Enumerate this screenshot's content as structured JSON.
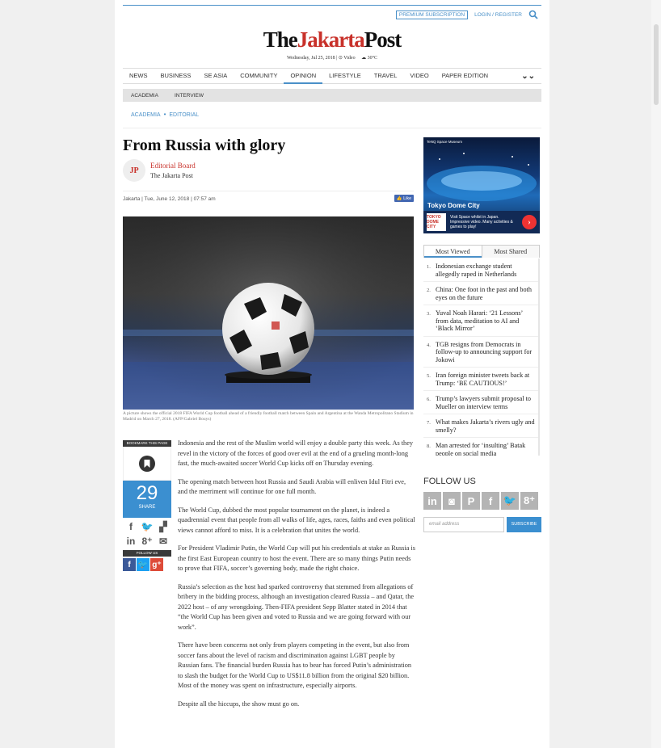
{
  "header": {
    "premium": "PREMIUM SUBSCRIPTION",
    "login": "LOGIN / REGISTER",
    "logo_the": "The",
    "logo_jakarta": "Jakarta",
    "logo_post": "Post",
    "date": "Wednesday, Jul 25, 2018",
    "video": "Video",
    "weather": "30°C"
  },
  "nav": [
    "NEWS",
    "BUSINESS",
    "SE ASIA",
    "COMMUNITY",
    "OPINION",
    "LIFESTYLE",
    "TRAVEL",
    "VIDEO",
    "PAPER EDITION"
  ],
  "subnav": [
    "ACADEMIA",
    "INTERVIEW"
  ],
  "breadcrumb": [
    "ACADEMIA",
    "EDITORIAL"
  ],
  "article": {
    "title": "From Russia with glory",
    "avatar": "JP",
    "author": "Editorial Board",
    "publication": "The Jakarta Post",
    "dateinfo": "Jakarta | Tue, June 12, 2018 | 07:57 am",
    "like": "Like",
    "caption": "A picture shows the official 2018 FIFA World Cup football ahead of a friendly football match between Spain and Argentina at the Wanda Metropolitano Stadium in Madrid on March 27, 2018. (AFP/Gabriel Bouys)",
    "paragraphs": [
      "Indonesia and the rest of the Muslim world will enjoy a double party this week. As they revel in the victory of the forces of good over evil at the end of a grueling month-long fast, the much-awaited soccer World Cup kicks off on Thursday evening.",
      "The opening match between host Russia and Saudi Arabia will enliven Idul Fitri eve, and the merriment will continue for one full month.",
      "The World Cup, dubbed the most popular tournament on the planet, is indeed a quadrennial event that people from all walks of life, ages, races, faiths and even political views cannot afford to miss. It is a celebration that unites the world.",
      "For President Vladimir Putin, the World Cup will put his credentials at stake as Russia is the first East European country to host the event. There are so many things Putin needs to prove that FIFA, soccer’s governing body, made the right choice.",
      "Russia’s selection as the host had sparked controversy that stemmed from allegations of bribery in the bidding process, although an investigation cleared Russia – and Qatar, the 2022 host – of any wrongdoing. Then-FIFA president Sepp Blatter stated in 2014 that “the World Cup has been given and voted to Russia and we are going forward with our work”.",
      "There have been concerns not only from players competing in the event, but also from soccer fans about the level of racism and discrimination against LGBT people by Russian fans. The financial burden Russia has to bear has forced Putin’s administration to slash the budget for the World Cup to US$11.8 billion from the original $20 billion. Most of the money was spent on infrastructure, especially airports.",
      "Despite all the hiccups, the show must go on."
    ]
  },
  "share": {
    "bookmark_label": "BOOKMARK THIS PAGE",
    "count": "29",
    "share_label": "SHARE",
    "follow_label": "FOLLOW US"
  },
  "ad": {
    "header": "TeNQ Space Museum",
    "title": "Tokyo Dome City",
    "logo": "TOKYO DOME CITY",
    "text": "Visit Space whilst in Japan. Impressive video. Many activities & games to play!"
  },
  "sidebar": {
    "tab_most_viewed": "Most Viewed",
    "tab_most_shared": "Most Shared",
    "most_viewed": [
      "Indonesian exchange student allegedly raped in Netherlands",
      "China: One foot in the past and both eyes on the future",
      "Yuval Noah Harari: ‘21 Lessons’ from data, meditation to AI and ‘Black Mirror’",
      "TGB resigns from Democrats in follow-up to announcing support for Jokowi",
      "Iran foreign minister tweets back at Trump: ‘BE CAUTIOUS!’",
      "Trump’s lawyers submit proposal to Mueller on interview terms",
      "What makes Jakarta’s rivers ugly and smelly?",
      "Man arrested for ‘insulting’ Batak people on social media"
    ],
    "follow_title": "FOLLOW US",
    "email_placeholder": "email address",
    "subscribe": "SUBSCRIBE"
  }
}
